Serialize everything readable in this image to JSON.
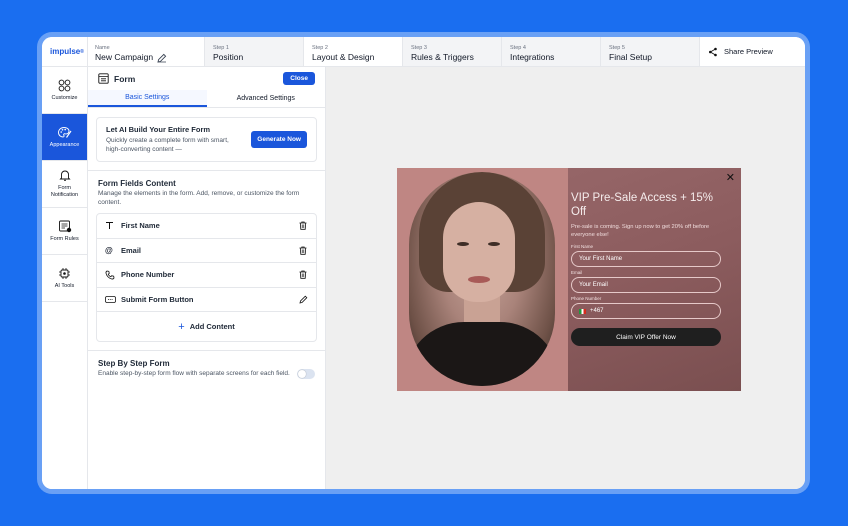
{
  "app": {
    "logo": "impulse",
    "logo_mark": "®"
  },
  "topbar": {
    "name_label": "Name",
    "campaign_name": "New Campaign",
    "steps": [
      {
        "label": "Step 1",
        "title": "Position"
      },
      {
        "label": "Step 2",
        "title": "Layout & Design"
      },
      {
        "label": "Step 3",
        "title": "Rules & Triggers"
      },
      {
        "label": "Step 4",
        "title": "Integrations"
      },
      {
        "label": "Step 5",
        "title": "Final Setup"
      }
    ],
    "share_label": "Share Preview"
  },
  "sidebar": {
    "items": [
      {
        "label": "Customize",
        "icon": "grid-icon",
        "active": false
      },
      {
        "label": "Appearance",
        "icon": "palette-icon",
        "active": true
      },
      {
        "label": "Form Notification",
        "icon": "bell-icon",
        "active": false
      },
      {
        "label": "Form Rules",
        "icon": "rules-icon",
        "active": false
      },
      {
        "label": "AI Tools",
        "icon": "ai-chip-icon",
        "active": false
      }
    ]
  },
  "panel": {
    "title": "Form",
    "close_label": "Close",
    "tabs": [
      "Basic Settings",
      "Advanced Settings"
    ],
    "active_tab": "Basic Settings",
    "ai": {
      "title": "Let AI Build Your Entire Form",
      "desc": "Quickly create a complete form with smart, high-converting content —",
      "button": "Generate Now"
    },
    "fields_section": {
      "title": "Form Fields Content",
      "desc": "Manage the elements in the form. Add, remove, or customize the form content."
    },
    "fields": [
      {
        "name": "First Name",
        "icon": "text-icon",
        "action": "trash-icon"
      },
      {
        "name": "Email",
        "icon": "at-icon",
        "action": "trash-icon"
      },
      {
        "name": "Phone Number",
        "icon": "phone-icon",
        "action": "trash-icon"
      },
      {
        "name": "Submit Form Button",
        "icon": "button-icon",
        "action": "pencil-icon"
      }
    ],
    "add_content": "Add Content",
    "step_by_step": {
      "title": "Step By Step Form",
      "desc": "Enable step-by-step form flow with separate screens for each field.",
      "enabled": false
    }
  },
  "popup": {
    "title": "VIP Pre-Sale Access + 15% Off",
    "desc": "Pre-sale is coming. Sign up now to get 20% off before everyone else!",
    "fields": [
      {
        "label": "First Name",
        "placeholder": "Your First Name"
      },
      {
        "label": "Email",
        "placeholder": "Your Email"
      },
      {
        "label": "Phone Number",
        "placeholder": "+467"
      }
    ],
    "button": "Claim VIP Offer Now"
  },
  "colors": {
    "accent": "#1a56db",
    "background": "#1a6ef0",
    "popup_bg": "#8c5c5e",
    "cta": "#1f1f1f"
  }
}
